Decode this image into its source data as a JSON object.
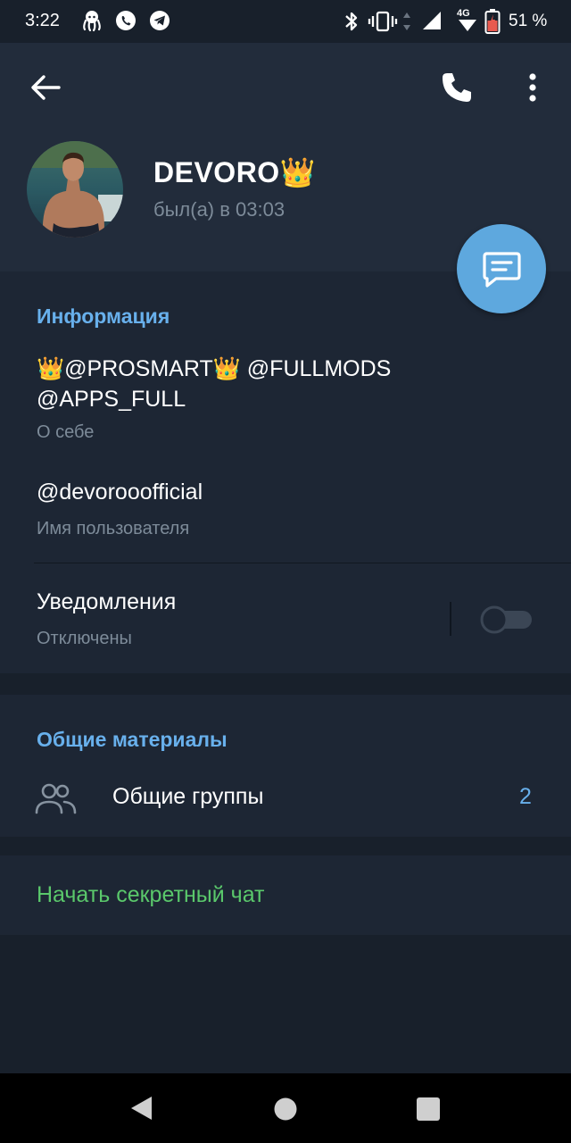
{
  "status_bar": {
    "time": "3:22",
    "network": "4G",
    "battery": "51 %",
    "icons": [
      "octopus-icon",
      "whatsapp-icon",
      "telegram-icon",
      "bluetooth-icon",
      "vibrate-icon",
      "signal-icon",
      "wifi-icon",
      "battery-icon"
    ]
  },
  "profile": {
    "name": "DEVORO👑",
    "last_seen": "был(а) в 03:03"
  },
  "info": {
    "section_title": "Информация",
    "bio": "👑@PROSMART👑 @FULLMODS @APPS_FULL",
    "bio_label": "О себе",
    "username": "@devorooofficial",
    "username_label": "Имя пользователя",
    "notifications_label": "Уведомления",
    "notifications_status": "Отключены",
    "notifications_enabled": false
  },
  "shared": {
    "section_title": "Общие материалы",
    "groups_label": "Общие группы",
    "groups_count": "2"
  },
  "secret_chat": {
    "label": "Начать секретный чат"
  },
  "colors": {
    "background": "#18202b",
    "header": "#222c3b",
    "section": "#1d2634",
    "accent_blue": "#68b0ec",
    "fab": "#5ea8de",
    "secret_green": "#5ac86b"
  }
}
